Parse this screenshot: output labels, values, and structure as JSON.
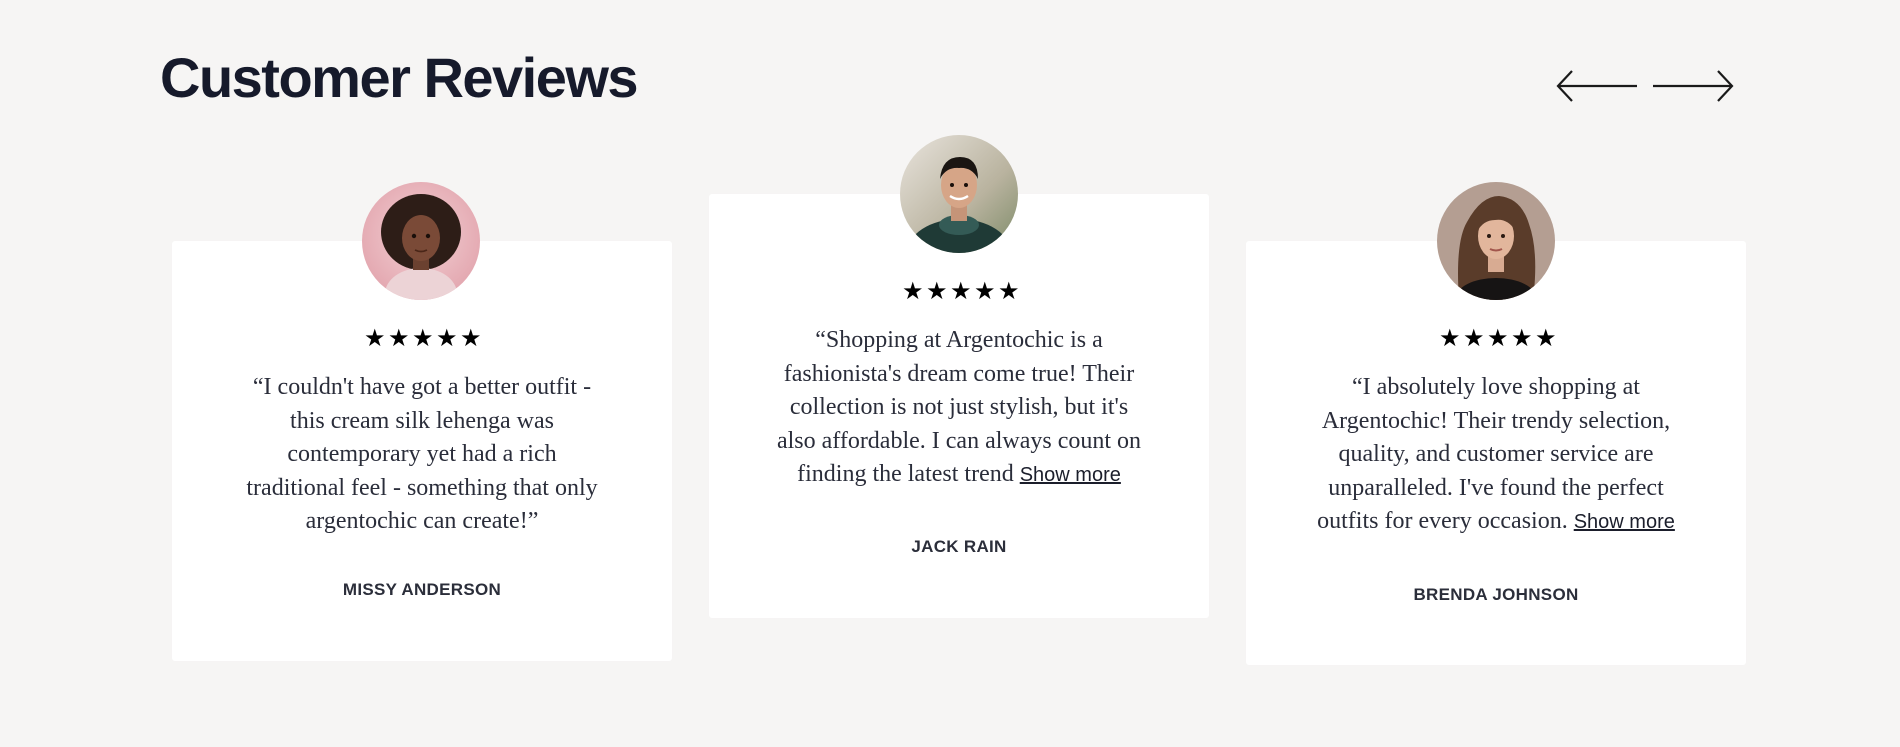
{
  "section": {
    "title": "Customer Reviews"
  },
  "nav": {
    "prev_icon": "arrow-left-icon",
    "next_icon": "arrow-right-icon"
  },
  "reviews": [
    {
      "stars": [
        "★",
        "★",
        "★",
        "★",
        "★"
      ],
      "rating": 5,
      "quote": "“I couldn't have got a better outfit - this cream silk lehenga was contemporary yet had a rich traditional feel - something that only argentochic can create!”",
      "show_more": "",
      "name": "MISSY ANDERSON"
    },
    {
      "stars": [
        "★",
        "★",
        "★",
        "★",
        "★"
      ],
      "rating": 5,
      "quote": "“Shopping at Argentochic is a fashionista's dream come true! Their collection is not just stylish, but it's also affordable. I can always count on finding the latest trend",
      "show_more": "Show more",
      "name": "JACK RAIN"
    },
    {
      "stars": [
        "★",
        "★",
        "★",
        "★",
        "★"
      ],
      "rating": 5,
      "quote": "“I absolutely love shopping at Argentochic! Their trendy selection, quality, and customer service are unparalleled. I've found the perfect outfits for every occasion.",
      "show_more": "Show more",
      "name": "BRENDA JOHNSON"
    }
  ],
  "colors": {
    "page_background": "#f6f5f4",
    "card_background": "#ffffff",
    "heading": "#161a2b",
    "text": "#2a2d3a"
  }
}
